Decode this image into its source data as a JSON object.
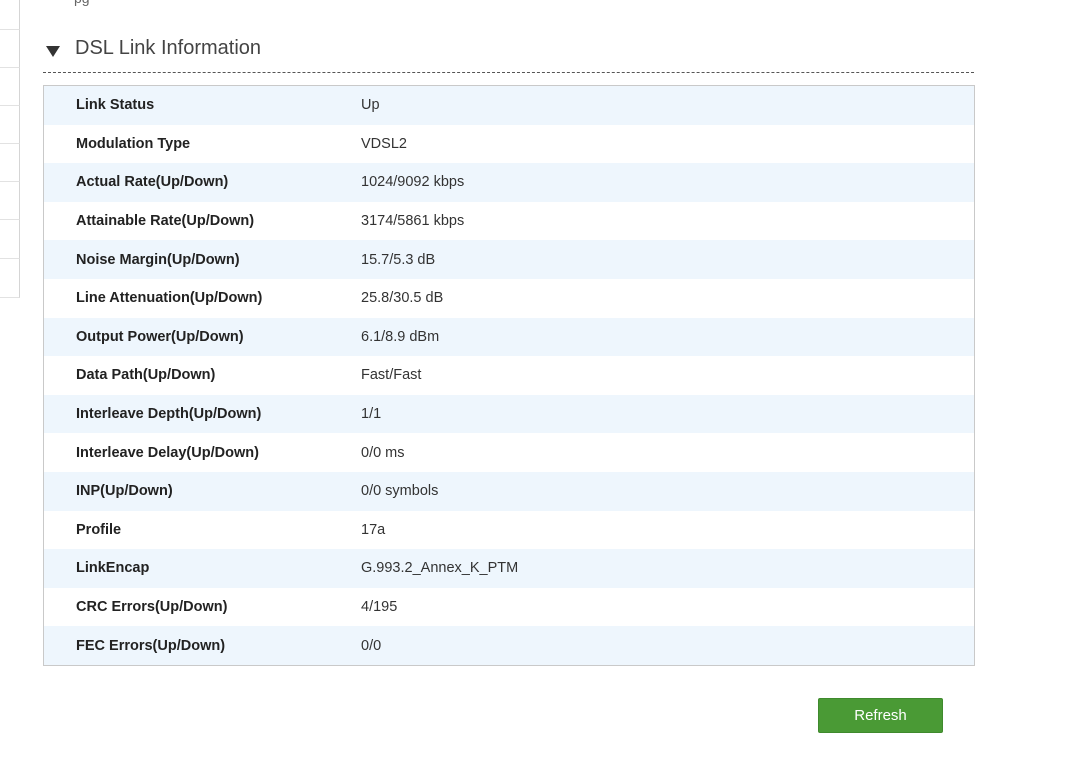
{
  "header_fragment": "pg",
  "section": {
    "title": "DSL Link Information"
  },
  "table": {
    "rows": [
      {
        "label": "Link Status",
        "value": "Up"
      },
      {
        "label": "Modulation Type",
        "value": "VDSL2"
      },
      {
        "label": "Actual Rate(Up/Down)",
        "value": "1024/9092 kbps"
      },
      {
        "label": "Attainable Rate(Up/Down)",
        "value": "3174/5861 kbps"
      },
      {
        "label": "Noise Margin(Up/Down)",
        "value": "15.7/5.3 dB"
      },
      {
        "label": "Line Attenuation(Up/Down)",
        "value": "25.8/30.5 dB"
      },
      {
        "label": "Output Power(Up/Down)",
        "value": "6.1/8.9 dBm"
      },
      {
        "label": "Data Path(Up/Down)",
        "value": "Fast/Fast"
      },
      {
        "label": "Interleave Depth(Up/Down)",
        "value": "1/1"
      },
      {
        "label": "Interleave Delay(Up/Down)",
        "value": "0/0 ms"
      },
      {
        "label": "INP(Up/Down)",
        "value": "0/0 symbols"
      },
      {
        "label": "Profile",
        "value": "17a"
      },
      {
        "label": "LinkEncap",
        "value": "G.993.2_Annex_K_PTM"
      },
      {
        "label": "CRC Errors(Up/Down)",
        "value": "4/195"
      },
      {
        "label": "FEC Errors(Up/Down)",
        "value": "0/0"
      }
    ]
  },
  "buttons": {
    "refresh_label": "Refresh"
  },
  "colors": {
    "accent_green": "#4a9a35",
    "row_stripe": "#eef6fd"
  }
}
